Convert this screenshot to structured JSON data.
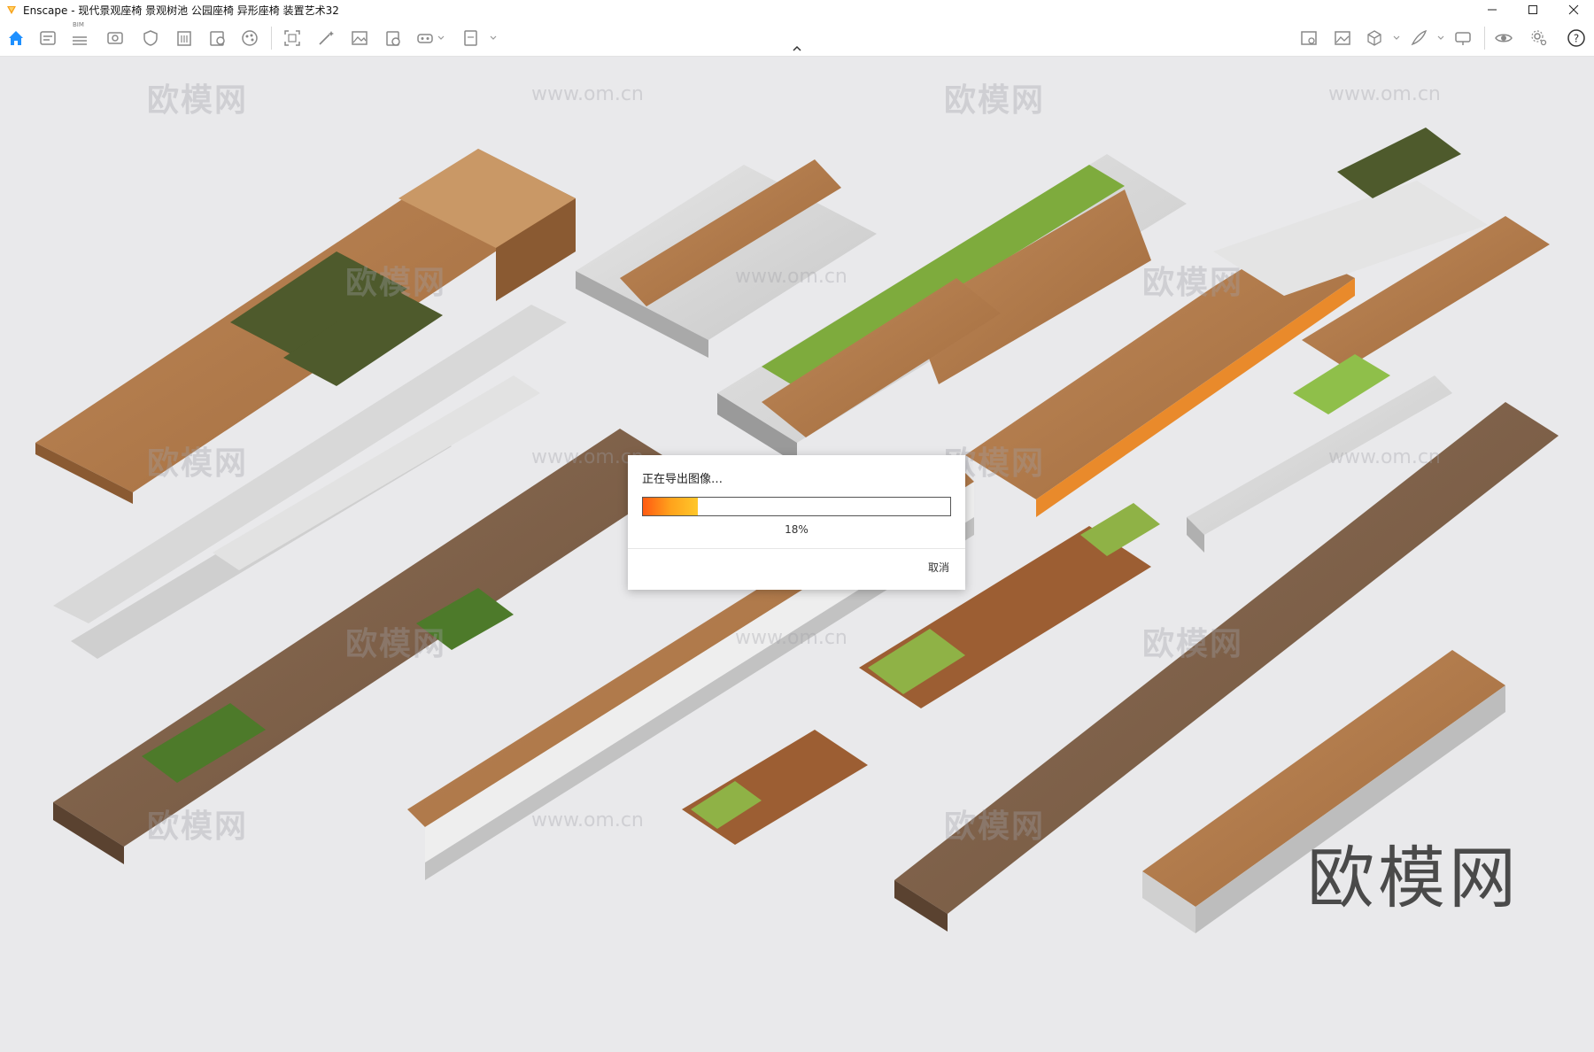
{
  "window": {
    "title": "Enscape - 现代景观座椅 景观树池 公园座椅 异形座椅 装置艺术32",
    "controls": [
      "minimize-icon",
      "maximize-icon",
      "close-icon"
    ]
  },
  "toolbar": {
    "bim_label": "BIM",
    "left_icons": [
      "home-icon",
      "asset-library-icon",
      "bim-icon",
      "visual-settings-icon",
      "shield-icon",
      "building-icon",
      "settings-file-icon",
      "material-editor-icon",
      "screenshot-icon",
      "magic-wand-icon",
      "image-render-icon",
      "video-editor-icon",
      "vr-headset-icon",
      "export-icon"
    ],
    "right_icons": [
      "site-context-icon",
      "gallery-icon",
      "cube-view-icon",
      "feather-icon",
      "presenter-icon",
      "visibility-eye-icon",
      "settings-gear-icon",
      "help-icon"
    ]
  },
  "viewport": {
    "watermark_text": "欧模网",
    "watermark_url": "www.om.cn",
    "logo_text": "欧模网",
    "background_color": "#e9e9eb"
  },
  "dialog": {
    "title": "正在导出图像…",
    "progress": 0.18,
    "progress_label": "18%",
    "cancel_label": "取消"
  },
  "colors": {
    "accent": "#1e90ff",
    "progress_start": "#ff5a12",
    "progress_end": "#ffc72a",
    "wood": "#b77a4a",
    "grass": "#7eab3d",
    "concrete": "#cfcfcf"
  }
}
